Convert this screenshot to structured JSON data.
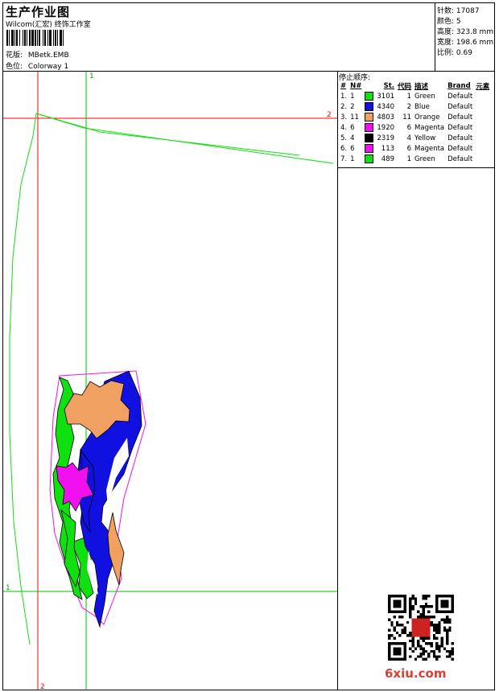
{
  "header": {
    "title": "生产作业图",
    "company": "Wilcom(汇宏) 终饰工作室",
    "design_label": "花版:",
    "design_value": "MBetk.EMB",
    "colorway_label": "色位:",
    "colorway_value": "Colorway 1"
  },
  "stats": {
    "stitches_label": "针数:",
    "stitches_value": "17087",
    "colors_label": "颜色:",
    "colors_value": "5",
    "height_label": "高度:",
    "height_value": "323.8 mm",
    "width_label": "宽度:",
    "width_value": "198.6 mm",
    "scale_label": "比例:",
    "scale_value": "0.69"
  },
  "stop_sequence": {
    "title": "停止顺序:",
    "headers": [
      "#",
      "N#",
      "St.",
      "代码",
      "描述",
      "Brand",
      "元素"
    ],
    "rows": [
      {
        "idx": "1.",
        "n": "1",
        "st": "3101",
        "code": "1",
        "desc": "Green",
        "brand": "Default",
        "color": "#10e010"
      },
      {
        "idx": "2.",
        "n": "2",
        "st": "4340",
        "code": "2",
        "desc": "Blue",
        "brand": "Default",
        "color": "#1010e0"
      },
      {
        "idx": "3.",
        "n": "11",
        "st": "4803",
        "code": "11",
        "desc": "Orange",
        "brand": "Default",
        "color": "#f0a060"
      },
      {
        "idx": "4.",
        "n": "6",
        "st": "1920",
        "code": "6",
        "desc": "Magenta",
        "brand": "Default",
        "color": "#f010f0"
      },
      {
        "idx": "5.",
        "n": "4",
        "st": "2319",
        "code": "4",
        "desc": "Yellow",
        "brand": "Default",
        "color": "#000000"
      },
      {
        "idx": "6.",
        "n": "6",
        "st": "113",
        "code": "6",
        "desc": "Magenta",
        "brand": "Default",
        "color": "#f010f0"
      },
      {
        "idx": "7.",
        "n": "1",
        "st": "489",
        "code": "1",
        "desc": "Green",
        "brand": "Default",
        "color": "#10e010"
      }
    ]
  },
  "axis_labels": {
    "green_v": "1",
    "green_h": "1",
    "red_v": "2",
    "red_h": "2"
  },
  "watermark": "6xiu.com",
  "colors": {
    "green": "#10e010",
    "blue": "#1010e0",
    "orange": "#f0a060",
    "magenta": "#f010f0",
    "guide_red": "#ff0000",
    "guide_green": "#00c000"
  }
}
